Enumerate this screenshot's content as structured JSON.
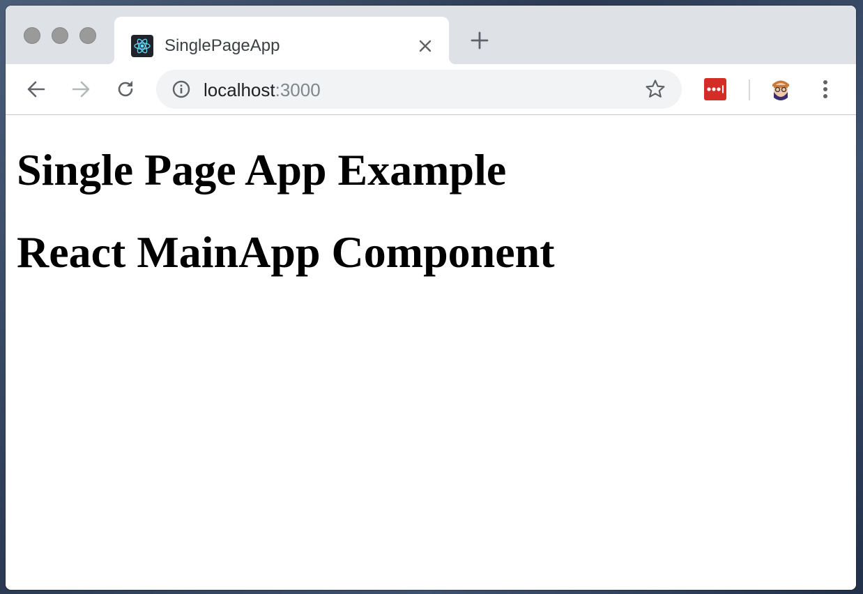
{
  "browser": {
    "tab": {
      "title": "SinglePageApp",
      "favicon": "react-logo-icon"
    },
    "toolbar": {
      "url_host": "localhost",
      "url_port": ":3000"
    },
    "icons": {
      "back": "arrow-left-icon",
      "forward": "arrow-right-icon",
      "reload": "reload-icon",
      "info": "info-icon",
      "bookmark": "star-icon",
      "extension": "lastpass-icon",
      "profile": "avatar",
      "menu": "more-vertical-icon",
      "new_tab": "plus-icon",
      "close_tab": "close-icon"
    }
  },
  "page": {
    "heading_1": "Single Page App Example",
    "heading_2": "React MainApp Component"
  },
  "colors": {
    "tabstrip": "#dee1e6",
    "omnibox": "#f1f3f4",
    "react_cyan": "#61dafb",
    "lastpass_red": "#d32d27"
  }
}
